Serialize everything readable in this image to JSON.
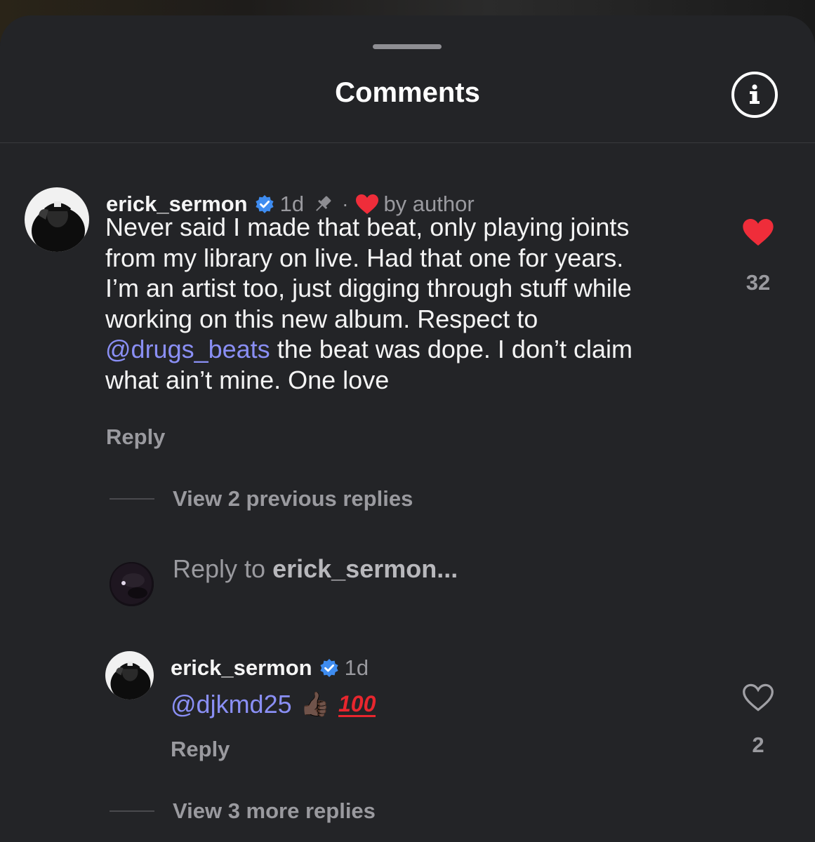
{
  "sheet": {
    "title": "Comments"
  },
  "comment": {
    "username": "erick_sermon",
    "timestamp": "1d",
    "separator": "·",
    "liked_by_author": "by author",
    "text_line1": "Never said I made that beat, only playing joints",
    "text_line2": "from my library on live. Had that one for years.",
    "text_line3": "I’m an artist too, just digging through stuff while",
    "text_line4": "working on this new album. Respect to",
    "mention": "@drugs_beats",
    "text_line5_rest": " the beat was dope. I don’t claim",
    "text_line6": "what ain’t mine. One love",
    "reply_label": "Reply",
    "like_count": "32",
    "liked": true
  },
  "thread": {
    "view_previous": "View 2 previous replies",
    "reply_placeholder_prefix": "Reply to ",
    "reply_placeholder_user": "erick_sermon...",
    "view_more": "View 3 more replies"
  },
  "reply": {
    "username": "erick_sermon",
    "timestamp": "1d",
    "mention": "@djkmd25",
    "emoji": "👍🏿",
    "emoji_hundred": "100",
    "reply_label": "Reply",
    "like_count": "2",
    "liked": false
  },
  "colors": {
    "background": "#232427",
    "heart_red": "#ef2d3a",
    "verified_blue": "#3e8cf0",
    "mention": "#8a8ff5",
    "muted": "#9a9a9f"
  },
  "icons": [
    "info-icon",
    "verified-badge-icon",
    "pin-icon",
    "heart-filled-icon",
    "heart-outline-icon"
  ]
}
